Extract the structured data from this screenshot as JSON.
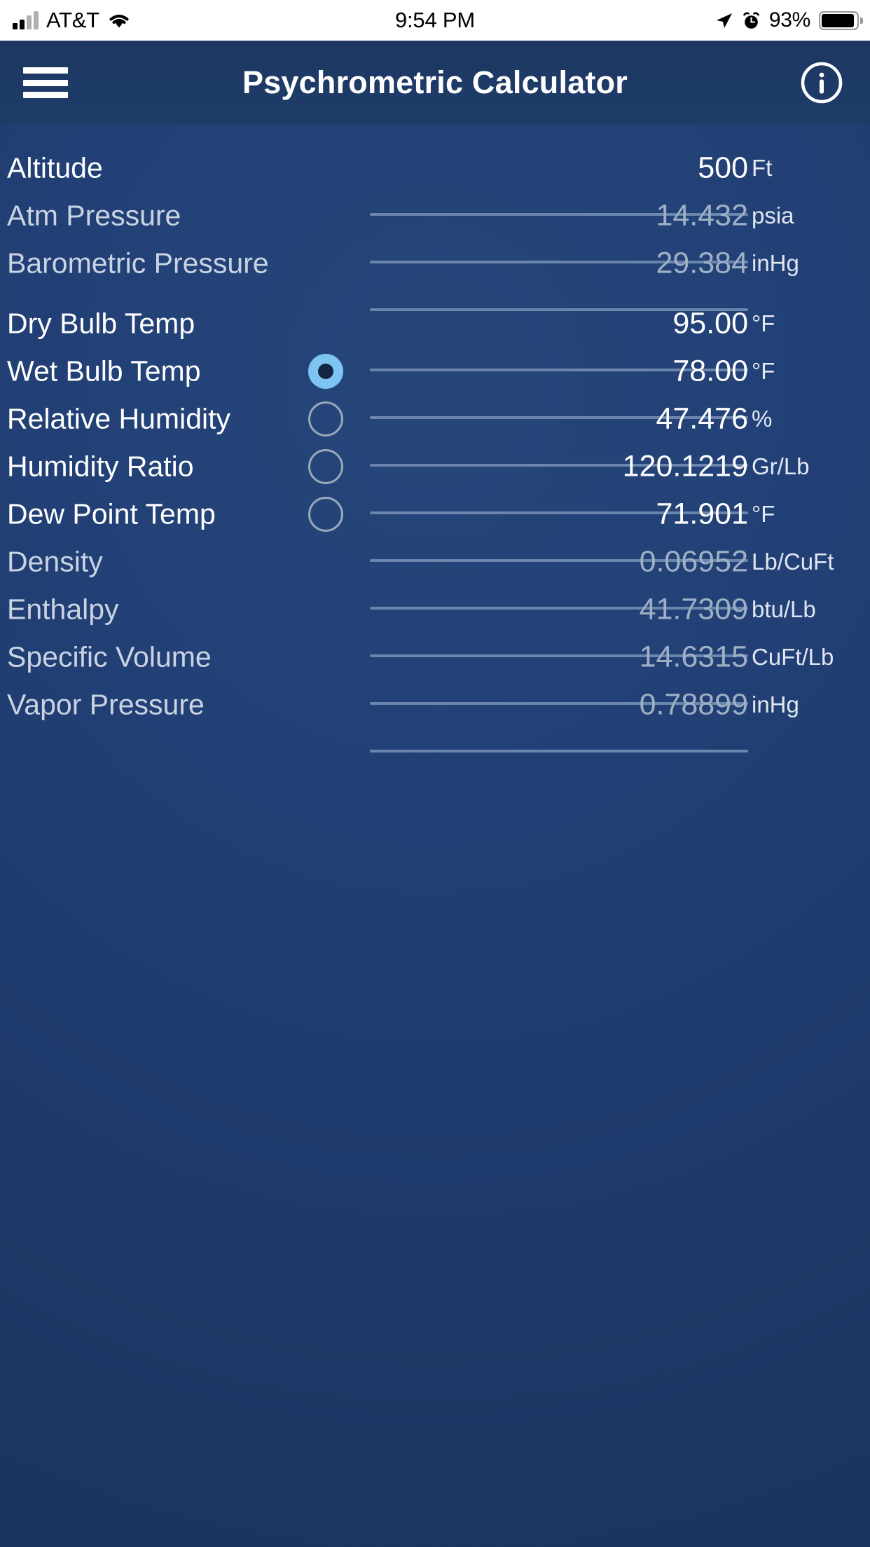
{
  "statusbar": {
    "carrier": "AT&T",
    "time": "9:54 PM",
    "battery_percent": "93%",
    "icons": [
      "signal-bars-icon",
      "wifi-icon",
      "location-arrow-icon",
      "alarm-clock-icon",
      "battery-icon"
    ]
  },
  "header": {
    "title": "Psychrometric Calculator",
    "menu_icon": "hamburger-menu-icon",
    "info_icon": "info-circle-icon"
  },
  "colors": {
    "background_top": "#26467a",
    "background_bottom": "#1c3460",
    "header": "#1d3762",
    "radio_selected": "#7dc4f2",
    "radio_unselected_border": "#9aa7b8",
    "underline": "#6b85ad",
    "text_active": "#ffffff",
    "text_readonly": "#9fafc4"
  },
  "rows": [
    {
      "label": "Altitude",
      "value": "500",
      "unit": "Ft",
      "readonly": false,
      "radio": "none"
    },
    {
      "label": "Atm Pressure",
      "value": "14.432",
      "unit": "psia",
      "readonly": true,
      "radio": "none"
    },
    {
      "label": "Barometric Pressure",
      "value": "29.384",
      "unit": "inHg",
      "readonly": true,
      "radio": "none"
    },
    {
      "label": "Dry Bulb Temp",
      "value": "95.00",
      "unit": "°F",
      "readonly": false,
      "radio": "none"
    },
    {
      "label": "Wet Bulb Temp",
      "value": "78.00",
      "unit": "°F",
      "readonly": false,
      "radio": "selected"
    },
    {
      "label": "Relative Humidity",
      "value": "47.476",
      "unit": "%",
      "readonly": false,
      "radio": "unselected"
    },
    {
      "label": "Humidity Ratio",
      "value": "120.1219",
      "unit": "Gr/Lb",
      "readonly": false,
      "radio": "unselected"
    },
    {
      "label": "Dew Point Temp",
      "value": "71.901",
      "unit": "°F",
      "readonly": false,
      "radio": "unselected"
    },
    {
      "label": "Density",
      "value": "0.06952",
      "unit": "Lb/CuFt",
      "readonly": true,
      "radio": "none"
    },
    {
      "label": "Enthalpy",
      "value": "41.7309",
      "unit": "btu/Lb",
      "readonly": true,
      "radio": "none"
    },
    {
      "label": "Specific Volume",
      "value": "14.6315",
      "unit": "CuFt/Lb",
      "readonly": true,
      "radio": "none"
    },
    {
      "label": "Vapor Pressure",
      "value": "0.78899",
      "unit": "inHg",
      "readonly": true,
      "radio": "none"
    }
  ]
}
